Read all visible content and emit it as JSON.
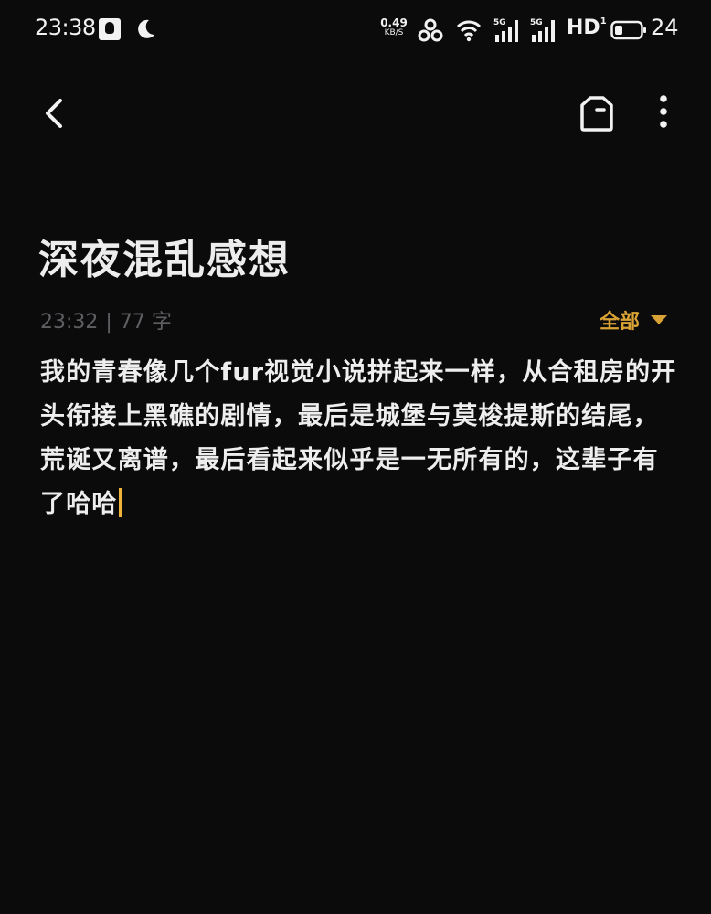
{
  "status_bar": {
    "time": "23:38",
    "net_speed_value": "0.49",
    "net_speed_unit": "KB/S",
    "sim1_label": "5G",
    "sim2_label": "5G",
    "hd_label": "HD",
    "battery_level": "24",
    "icons": [
      "qq-icon",
      "moon-icon",
      "hotspot-icon",
      "wifi-icon",
      "signal-icon",
      "signal-icon",
      "battery-icon"
    ]
  },
  "toolbar": {
    "back_icon": "chevron-left-icon",
    "tag_icon": "tag-icon",
    "more_icon": "more-vertical-icon"
  },
  "note": {
    "title": "深夜混乱感想",
    "time": "23:32",
    "separator": "|",
    "word_count": "77 字",
    "folder": "全部",
    "body": "我的青春像几个fur视觉小说拼起来一样，从合租房的开头衔接上黑礁的剧情，最后是城堡与莫梭提斯的结尾，荒诞又离谱，最后看起来似乎是一无所有的，这辈子有了哈哈"
  },
  "colors": {
    "background": "#0b0b0c",
    "accent": "#d9a234",
    "meta_text": "#5f5f63",
    "body_text": "#eeeeee"
  }
}
